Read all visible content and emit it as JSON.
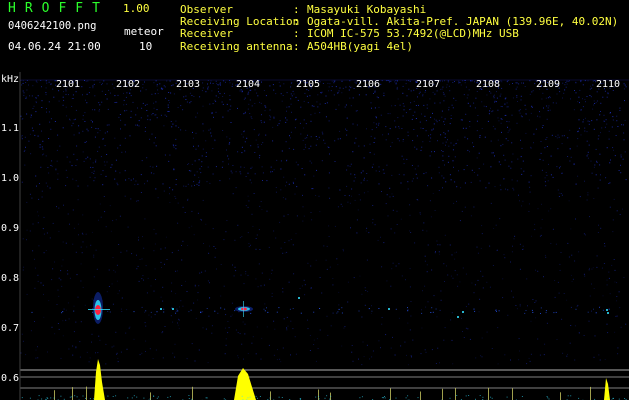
{
  "header": {
    "title": "HROFFT",
    "version": "1.00",
    "filename": "0406242100.png",
    "datetime": "04.06.24 21:00",
    "count_label": "meteor",
    "count_value": "10"
  },
  "info": [
    {
      "label": "Observer",
      "sep": ":",
      "value": "Masayuki Kobayashi"
    },
    {
      "label": "Receiving Location",
      "sep": ":",
      "value": "Ogata-vill. Akita-Pref. JAPAN (139.96E, 40.02N)"
    },
    {
      "label": "Receiver",
      "sep": ":",
      "value": "ICOM IC-575 53.7492(@LCD)MHz USB"
    },
    {
      "label": "Receiving antenna",
      "sep": ":",
      "value": "A504HB(yagi 4el)"
    }
  ],
  "axes": {
    "freq_unit": "kHz",
    "freq_ticks": [
      "1.1",
      "1.0",
      "0.9",
      "0.8",
      "0.7",
      "0.6"
    ],
    "time_ticks": [
      "2101",
      "2102",
      "2103",
      "2104",
      "2105",
      "2106",
      "2107",
      "2108",
      "2109",
      "2110"
    ]
  },
  "colors": {
    "title_green": "#2bff2b",
    "label_yellow": "#ffff40",
    "text_white": "#ffffff",
    "noise_blue": "#1a2aa8",
    "meteor_red": "#ff2040",
    "meteor_cyan": "#30e0ff",
    "bar_yellow": "#ffff00"
  }
}
